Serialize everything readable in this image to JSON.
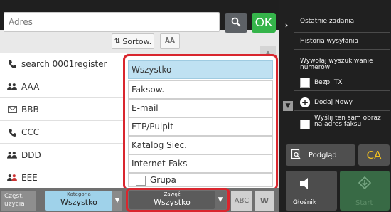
{
  "header": {
    "address_placeholder": "Adres",
    "ok_label": "OK"
  },
  "toolbar": {
    "sort_label": "Sortow."
  },
  "address_list": [
    {
      "name": "search 0001register",
      "icon": "phone-fax-icon"
    },
    {
      "name": "AAA",
      "icon": "group-icon"
    },
    {
      "name": "BBB",
      "icon": "email-icon"
    },
    {
      "name": "CCC",
      "icon": "phone-fax-icon"
    },
    {
      "name": "DDD",
      "icon": "group-icon"
    },
    {
      "name": "EEE",
      "icon": "group-icon"
    }
  ],
  "dropdown": {
    "options": [
      {
        "label": "Wszystko",
        "selected": true
      },
      {
        "label": "Faksow.",
        "selected": false
      },
      {
        "label": "E-mail",
        "selected": false
      },
      {
        "label": "FTP/Pulpit",
        "selected": false
      },
      {
        "label": "Katalog Siec.",
        "selected": false
      },
      {
        "label": "Internet-Faks",
        "selected": false
      },
      {
        "label": "Grupa",
        "selected": false
      }
    ]
  },
  "bottom": {
    "freq_label": "Częst. użycia",
    "category_caption": "Kategoria",
    "category_value": "Wszystko",
    "narrow_caption": "Zawęź",
    "narrow_value": "Wszystko",
    "abc_label": "ABC",
    "w_label": "W"
  },
  "side_panel": {
    "recent_jobs": "Ostatnie zadania",
    "send_history": "Historia wysyłania",
    "global_search": "Wywołaj wyszukiwanie numerów",
    "bcc_tx": "Bezp. TX",
    "add_new": "Dodaj Nowy",
    "send_same_image": "Wyślij ten sam obraz na adres faksu",
    "preview": "Podgląd",
    "ca": "CA",
    "speaker": "Głośnik",
    "start": "Start"
  },
  "colors": {
    "accent_green": "#35b44a",
    "highlight_red": "#d9262e",
    "selected_blue": "#bfe1f2",
    "ca_yellow": "#f0c020"
  }
}
